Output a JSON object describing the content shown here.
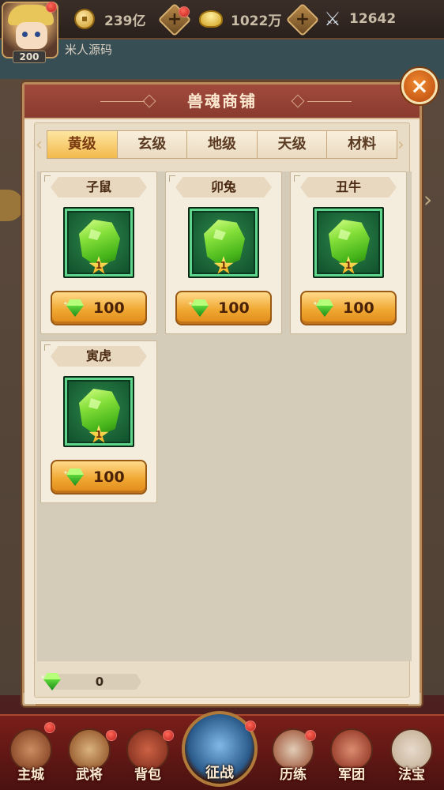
{
  "topbar": {
    "player_level": "200",
    "player_name": "米人源码",
    "copper": "239亿",
    "gold_ingot": "1022万",
    "power": "12642",
    "icons": [
      "copper-coin-icon",
      "gold-ingot-icon",
      "crossed-swords-icon"
    ]
  },
  "shop": {
    "title": "兽魂商铺",
    "close_label": "×",
    "tabs": [
      {
        "label": "黄级",
        "active": true
      },
      {
        "label": "玄级",
        "active": false
      },
      {
        "label": "地级",
        "active": false
      },
      {
        "label": "天级",
        "active": false
      },
      {
        "label": "材料",
        "active": false
      }
    ],
    "items": [
      {
        "name": "子鼠",
        "stars": "1",
        "price": "100",
        "icon": "green-beast-soul-gem-icon"
      },
      {
        "name": "卯兔",
        "stars": "1",
        "price": "100",
        "icon": "green-beast-soul-gem-icon"
      },
      {
        "name": "丑牛",
        "stars": "1",
        "price": "100",
        "icon": "green-beast-soul-gem-icon"
      },
      {
        "name": "寅虎",
        "stars": "1",
        "price": "100",
        "icon": "green-beast-soul-gem-icon"
      }
    ],
    "currency_icon": "green-diamond-icon",
    "balance": "0"
  },
  "bottom_nav": [
    {
      "label": "主城",
      "icon": "city-gate-icon"
    },
    {
      "label": "武将",
      "icon": "general-portrait-icon"
    },
    {
      "label": "背包",
      "icon": "backpack-icon"
    },
    {
      "label": "征战",
      "icon": "battle-emblem-icon"
    },
    {
      "label": "历练",
      "icon": "training-icon"
    },
    {
      "label": "军团",
      "icon": "legion-flag-icon"
    },
    {
      "label": "法宝",
      "icon": "treasure-icon"
    }
  ],
  "colors": {
    "header": "#8a3a2e",
    "panel_bg": "#f1e6d3",
    "tab_active": "#f3b94c",
    "buy_button": "#f0a832",
    "item_frame": "#0d4a2a",
    "nav_bg": "#7a1e1a"
  }
}
